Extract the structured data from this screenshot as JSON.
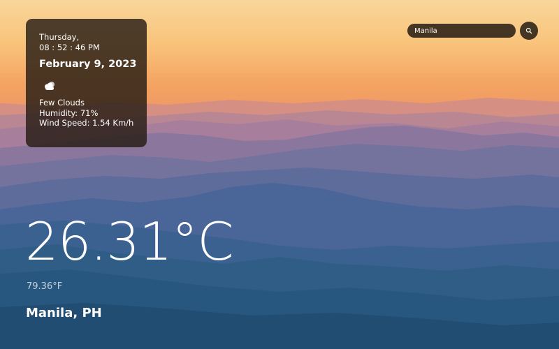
{
  "card": {
    "weekday": "Thursday,",
    "time": "08 : 52 : 46 PM",
    "date": "February 9, 2023",
    "weather_icon": "cloud-icon",
    "condition": "Few Clouds",
    "humidity": "Humidity: 71%",
    "wind": "Wind Speed: 1.54 Km/h"
  },
  "search": {
    "value": "Manila",
    "button_icon": "search-icon"
  },
  "main": {
    "temp_c": "26.31°C",
    "temp_f": "79.36°F",
    "location": "Manila, PH"
  },
  "colors": {
    "card_bg": "#261c14",
    "text": "#ffffff",
    "sky_top": "#f8d69a",
    "sky_mid": "#f3a55e",
    "mountains_far": "#a77f9c",
    "mountains_near": "#27577f"
  }
}
